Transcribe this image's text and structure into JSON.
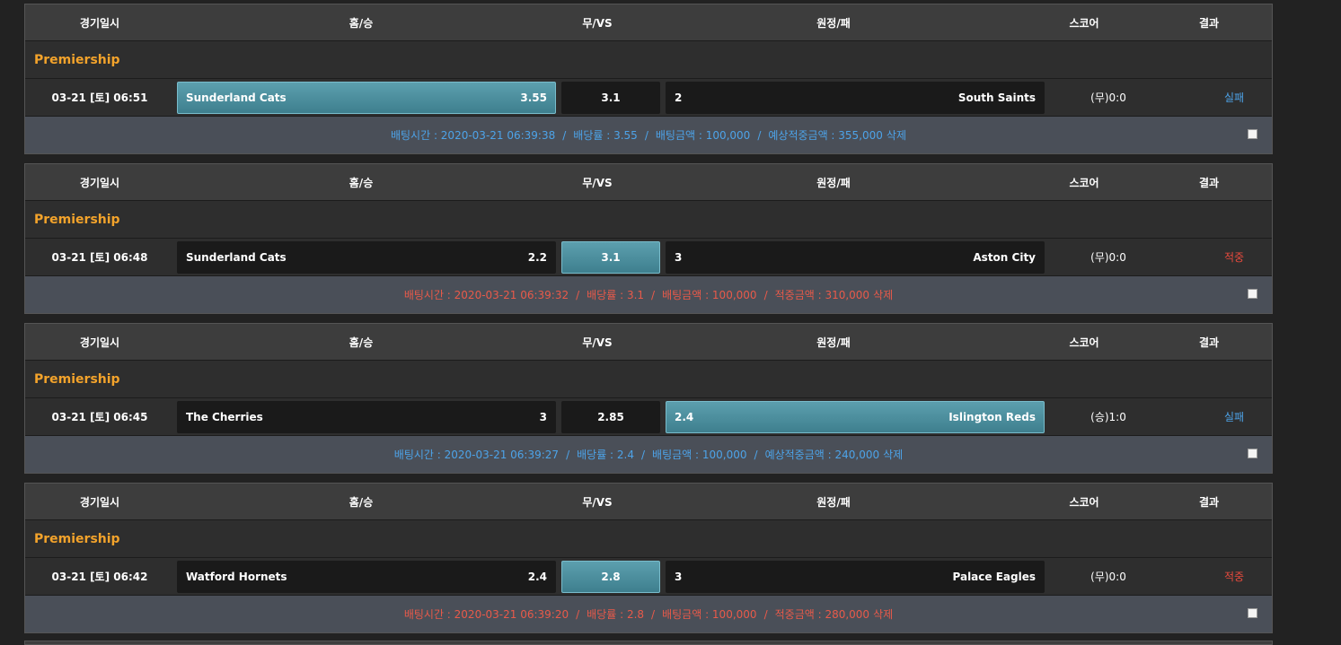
{
  "header": {
    "date": "경기일시",
    "home": "홈/승",
    "draw": "무/VS",
    "away": "원정/패",
    "score": "스코어",
    "result": "결과"
  },
  "bets": [
    {
      "league": "Premiership",
      "date": "03-21 [토] 06:51",
      "home_team": "Sunderland Cats",
      "home_odds": "3.55",
      "draw_odds": "3.1",
      "away_odds": "2",
      "away_team": "South Saints",
      "selected": "home",
      "score": "(무)0:0",
      "result": "실패",
      "outcome": "lose",
      "bet_time": "배팅시간 : 2020-03-21 06:39:38",
      "bet_rate": "배당률 : 3.55",
      "bet_amount": "배팅금액 : 100,000",
      "payout": "예상적중금액 : 355,000",
      "delete_label": "삭제"
    },
    {
      "league": "Premiership",
      "date": "03-21 [토] 06:48",
      "home_team": "Sunderland Cats",
      "home_odds": "2.2",
      "draw_odds": "3.1",
      "away_odds": "3",
      "away_team": "Aston City",
      "selected": "draw",
      "score": "(무)0:0",
      "result": "적중",
      "outcome": "win",
      "bet_time": "배팅시간 : 2020-03-21 06:39:32",
      "bet_rate": "배당률 : 3.1",
      "bet_amount": "배팅금액 : 100,000",
      "payout": "적중금액 : 310,000",
      "delete_label": "삭제"
    },
    {
      "league": "Premiership",
      "date": "03-21 [토] 06:45",
      "home_team": "The Cherries",
      "home_odds": "3",
      "draw_odds": "2.85",
      "away_odds": "2.4",
      "away_team": "Islington Reds",
      "selected": "away",
      "score": "(승)1:0",
      "result": "실패",
      "outcome": "lose",
      "bet_time": "배팅시간 : 2020-03-21 06:39:27",
      "bet_rate": "배당률 : 2.4",
      "bet_amount": "배팅금액 : 100,000",
      "payout": "예상적중금액 : 240,000",
      "delete_label": "삭제"
    },
    {
      "league": "Premiership",
      "date": "03-21 [토] 06:42",
      "home_team": "Watford Hornets",
      "home_odds": "2.4",
      "draw_odds": "2.8",
      "away_odds": "3",
      "away_team": "Palace Eagles",
      "selected": "draw",
      "score": "(무)0:0",
      "result": "적중",
      "outcome": "win",
      "bet_time": "배팅시간 : 2020-03-21 06:39:20",
      "bet_rate": "배당률 : 2.8",
      "bet_amount": "배팅금액 : 100,000",
      "payout": "적중금액 : 280,000",
      "delete_label": "삭제"
    }
  ],
  "colors": {
    "league": "#f3a32b",
    "lose": "#4da3e8",
    "win": "#e84a3d",
    "selected_cell": "#4e8f9e"
  }
}
